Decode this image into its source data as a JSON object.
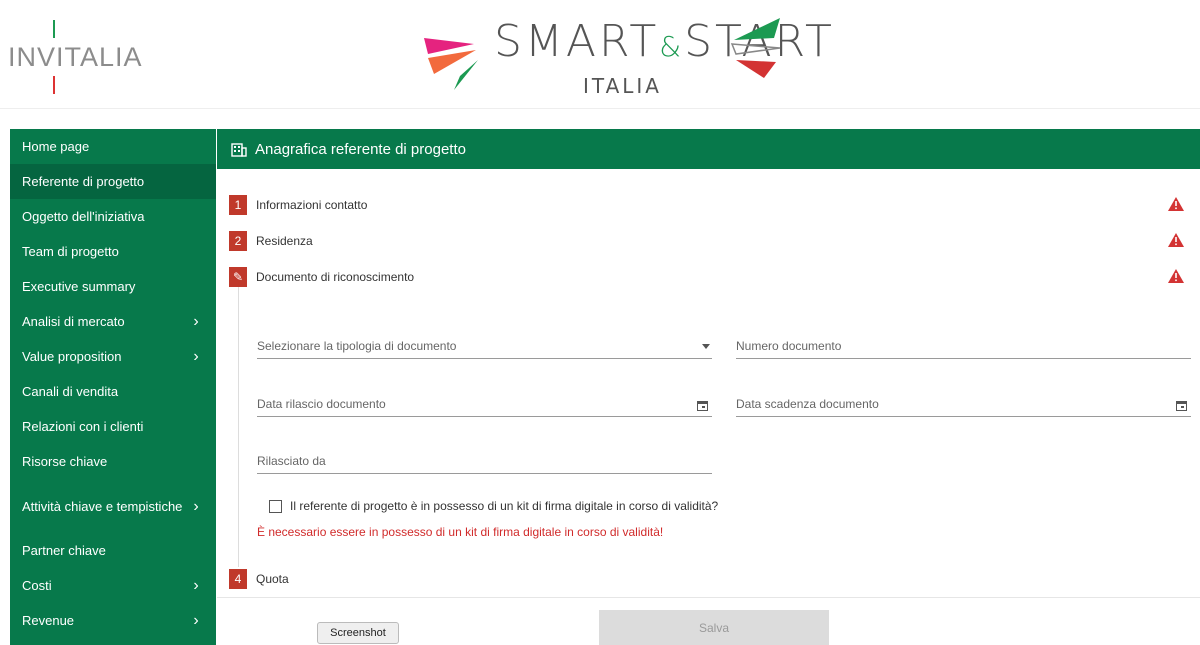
{
  "header": {
    "invitalia_logo_text": "INVITALIA",
    "smart_start_logo_text": "SMART",
    "smart_start_amp": "&",
    "smart_start_logo_text2": "START",
    "smart_start_sub": "ITALIA",
    "colors": {
      "green": "#1c9a52",
      "red": "#d33333",
      "magenta": "#e5237f",
      "orange": "#f26a3d"
    }
  },
  "sidebar": {
    "items": [
      {
        "label": "Home page",
        "chevron": false,
        "active": false
      },
      {
        "label": "Referente di progetto",
        "chevron": false,
        "active": true
      },
      {
        "label": "Oggetto dell'iniziativa",
        "chevron": false,
        "active": false
      },
      {
        "label": "Team di progetto",
        "chevron": false,
        "active": false
      },
      {
        "label": "Executive summary",
        "chevron": false,
        "active": false
      },
      {
        "label": "Analisi di mercato",
        "chevron": true,
        "active": false
      },
      {
        "label": "Value proposition",
        "chevron": true,
        "active": false
      },
      {
        "label": "Canali di vendita",
        "chevron": false,
        "active": false
      },
      {
        "label": "Relazioni con i clienti",
        "chevron": false,
        "active": false
      },
      {
        "label": "Risorse chiave",
        "chevron": false,
        "active": false
      },
      {
        "label": "Attività chiave e tempistiche",
        "chevron": true,
        "active": false
      },
      {
        "label": "Partner chiave",
        "chevron": false,
        "active": false
      },
      {
        "label": "Costi",
        "chevron": true,
        "active": false
      },
      {
        "label": "Revenue",
        "chevron": true,
        "active": false
      }
    ],
    "colors": {
      "bg": "#07794b",
      "active_bg": "#056540"
    }
  },
  "panel": {
    "title": "Anagrafica referente di progetto",
    "icon": "building-icon"
  },
  "steps": [
    {
      "num": "1",
      "label": "Informazioni contatto",
      "warning": true
    },
    {
      "num": "2",
      "label": "Residenza",
      "warning": true
    },
    {
      "num": "✎",
      "label": "Documento di riconoscimento",
      "warning": true
    },
    {
      "num": "4",
      "label": "Quota",
      "warning": false
    }
  ],
  "form": {
    "doc_type_placeholder": "Selezionare la tipologia di documento",
    "doc_number_placeholder": "Numero documento",
    "issue_date_placeholder": "Data rilascio documento",
    "expiry_date_placeholder": "Data scadenza documento",
    "issued_by_placeholder": "Rilasciato da",
    "digital_kit_question": "Il referente di progetto è in possesso di un kit di firma digitale in corso di validità?",
    "digital_kit_checked": false,
    "digital_kit_error": "È necessario essere in possesso di un kit di firma digitale in corso di validità!"
  },
  "buttons": {
    "screenshot": "Screenshot",
    "save": "Salva"
  }
}
